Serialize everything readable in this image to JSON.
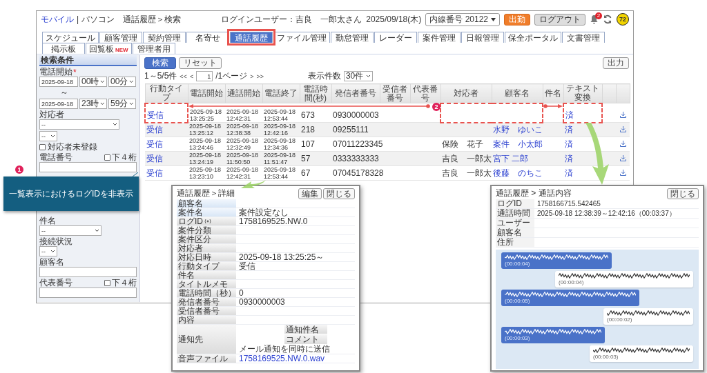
{
  "header": {
    "mode_links": [
      {
        "label": "モバイル",
        "selected": false
      },
      {
        "label": "パソコン",
        "selected": true
      }
    ],
    "separator": "|",
    "breadcrumb": "通話履歴＞検索",
    "login_user": "ログインユーザー：吉良　一郎太さん",
    "date": "2025/09/18(木)",
    "extension": "内線番号  20122",
    "clock_in_button": "出勤",
    "logout_button": "ログアウト",
    "notification_count": "2",
    "points": "72"
  },
  "tab_rows": [
    [
      {
        "label": "スケジュール",
        "selected": false
      },
      {
        "label": "顧客管理",
        "selected": false
      },
      {
        "label": "契約管理",
        "selected": false
      },
      {
        "label": "名寄せ",
        "selected": false
      },
      {
        "label": "通話履歴",
        "selected": true
      },
      {
        "label": "ファイル管理",
        "selected": false
      },
      {
        "label": "勤怠管理",
        "selected": false
      },
      {
        "label": "レーダー",
        "selected": false
      },
      {
        "label": "案件管理",
        "selected": false
      },
      {
        "label": "日報管理",
        "selected": false
      },
      {
        "label": "保全ポータル",
        "selected": false
      },
      {
        "label": "文書管理",
        "selected": false
      }
    ],
    [
      {
        "label": "掲示板",
        "selected": false
      },
      {
        "label": "回覧板",
        "badge": "NEW",
        "selected": false
      },
      {
        "label": "管理者用",
        "selected": false
      }
    ]
  ],
  "sidebar": {
    "title": "検索条件",
    "fields": [
      {
        "kind": "datetime",
        "label": "電話開始",
        "required_mark": "*",
        "date": "2025-09-18",
        "hour": "00時",
        "minute": "00分"
      },
      {
        "kind": "range_separator",
        "text": "～"
      },
      {
        "kind": "datetime",
        "date": "2025-09-18",
        "hour": "23時",
        "minute": "59分"
      },
      {
        "kind": "select_wide",
        "label": "対応者",
        "value": "--"
      },
      {
        "kind": "select_small",
        "value": "--"
      },
      {
        "kind": "checkbox",
        "label": "対応者未登録",
        "checked": false
      },
      {
        "kind": "text",
        "label": "電話番号",
        "option": {
          "label": "下４桁",
          "checked": false
        }
      },
      {
        "kind": "select_medium",
        "label": "件名",
        "value": "--"
      },
      {
        "kind": "select_small",
        "label": "接続状況",
        "value": "--"
      },
      {
        "kind": "text",
        "label": "顧客名"
      },
      {
        "kind": "text",
        "label": "代表番号",
        "option": {
          "label": "下４桁",
          "checked": false
        }
      }
    ]
  },
  "toolbar": {
    "search_button": "検索",
    "reset_button": "リセット",
    "export_button": "出力"
  },
  "pager": {
    "summary": "1～5/5件",
    "first": "<<",
    "prev": "<",
    "page": "1",
    "total": "/1ページ",
    "next": ">",
    "last": ">>",
    "per_page_label": "表示件数",
    "per_page": "30件"
  },
  "table": {
    "columns": [
      {
        "label": "行動タイプ",
        "kind": "link"
      },
      {
        "label": "電話開始",
        "kind": "datetime"
      },
      {
        "label": "通話開始",
        "kind": "datetime"
      },
      {
        "label": "電話終了",
        "kind": "datetime"
      },
      {
        "label": "電話時間(秒)",
        "kind": "text"
      },
      {
        "label": "発信者番号",
        "kind": "text"
      },
      {
        "label": "受信者番号",
        "kind": "text"
      },
      {
        "label": "代表番号",
        "kind": "text"
      },
      {
        "label": "対応者",
        "kind": "text"
      },
      {
        "label": "顧客名",
        "kind": "link"
      },
      {
        "label": "件名",
        "kind": "text"
      },
      {
        "label": "テキスト変換",
        "kind": "link"
      }
    ],
    "rows": [
      {
        "cells": [
          "受信",
          "2025-09-18 13:25:25",
          "2025-09-18 12:42:31",
          "2025-09-18 12:53:44",
          "673",
          "0930000003",
          "",
          "",
          "",
          "",
          "",
          "済"
        ]
      },
      {
        "cells": [
          "受信",
          "2025-09-18 13:25:12",
          "2025-09-18 12:38:38",
          "2025-09-18 12:42:16",
          "218",
          "09255111",
          "",
          "",
          "",
          "水野　ゆいこ",
          "",
          "済"
        ]
      },
      {
        "cells": [
          "受信",
          "2025-09-18 13:24:46",
          "2025-09-18 12:32:49",
          "2025-09-18 12:34:36",
          "107",
          "07011223345",
          "",
          "",
          "保険　花子",
          "案件　小太郎",
          "",
          "済"
        ]
      },
      {
        "cells": [
          "受信",
          "2025-09-18 13:24:19",
          "2025-09-18 11:50:50",
          "2025-09-18 11:51:47",
          "57",
          "0333333333",
          "",
          "",
          "吉良　一郎太",
          "宮下 二郎",
          "",
          "済"
        ]
      },
      {
        "cells": [
          "受信",
          "2025-09-18 13:23:10",
          "2025-09-18 12:42:31",
          "2025-09-18 12:53:44",
          "67",
          "07045178328",
          "",
          "",
          "吉良　一郎太",
          "後藤　のちこ",
          "",
          "済"
        ]
      }
    ]
  },
  "detail_popup": {
    "title": "通話履歴＞詳細",
    "edit_button": "編集",
    "close_button": "閉じる",
    "rows": [
      {
        "label": "顧客名",
        "kind": "customer"
      },
      {
        "label": "案件名",
        "value": "案件設定なし",
        "kind": "customer"
      },
      {
        "label": "ログID",
        "value": "1758169525.NW.0",
        "kind": "id"
      },
      {
        "label": "案件分類",
        "kind": "field"
      },
      {
        "label": "案件区分",
        "kind": "field"
      },
      {
        "label": "対応者",
        "kind": "field"
      },
      {
        "label": "対応日時",
        "value": "2025-09-18 13:25:25～",
        "kind": "field"
      },
      {
        "label": "行動タイプ",
        "value": "受信",
        "kind": "field"
      },
      {
        "label": "件名",
        "kind": "field"
      },
      {
        "label": "タイトルメモ",
        "kind": "field"
      },
      {
        "label": "電話時間（秒）",
        "value": "0",
        "kind": "field"
      },
      {
        "label": "発信者番号",
        "value": "0930000003",
        "kind": "field"
      },
      {
        "label": "受信者番号",
        "kind": "field"
      },
      {
        "label": "内容",
        "kind": "field"
      }
    ],
    "notify": {
      "label": "通知先",
      "subject_label": "通知件名",
      "comment_label": "コメント",
      "mail_option": "メール通知を同時に送信"
    },
    "audio": {
      "label": "音声ファイル",
      "file": "1758169525.NW.0.wav"
    }
  },
  "transcript_popup": {
    "title": "通話履歴 > 通話内容",
    "close_button": "閉じる",
    "rows": [
      {
        "label": "ログID",
        "value": "1758166715.542465"
      },
      {
        "label": "通話時間",
        "value": "2025-09-18 12:38:39～12:42:16（00:03:37）"
      },
      {
        "label": "ユーザー"
      },
      {
        "label": "顧客名"
      },
      {
        "label": "住所"
      }
    ],
    "messages": [
      {
        "kind": "caller",
        "time": "(00:00:04)"
      },
      {
        "kind": "agent",
        "time": "(00:00:04)"
      },
      {
        "kind": "caller",
        "time": "(00:00:05)"
      },
      {
        "kind": "agent",
        "time": "(00:00:02)"
      },
      {
        "kind": "caller",
        "time": "(00:00:03)"
      },
      {
        "kind": "agent",
        "time": "(00:00:03)"
      }
    ]
  },
  "annotations": {
    "markers": [
      "1",
      "2"
    ],
    "callout": "一覧表示におけるログIDを非表示"
  }
}
